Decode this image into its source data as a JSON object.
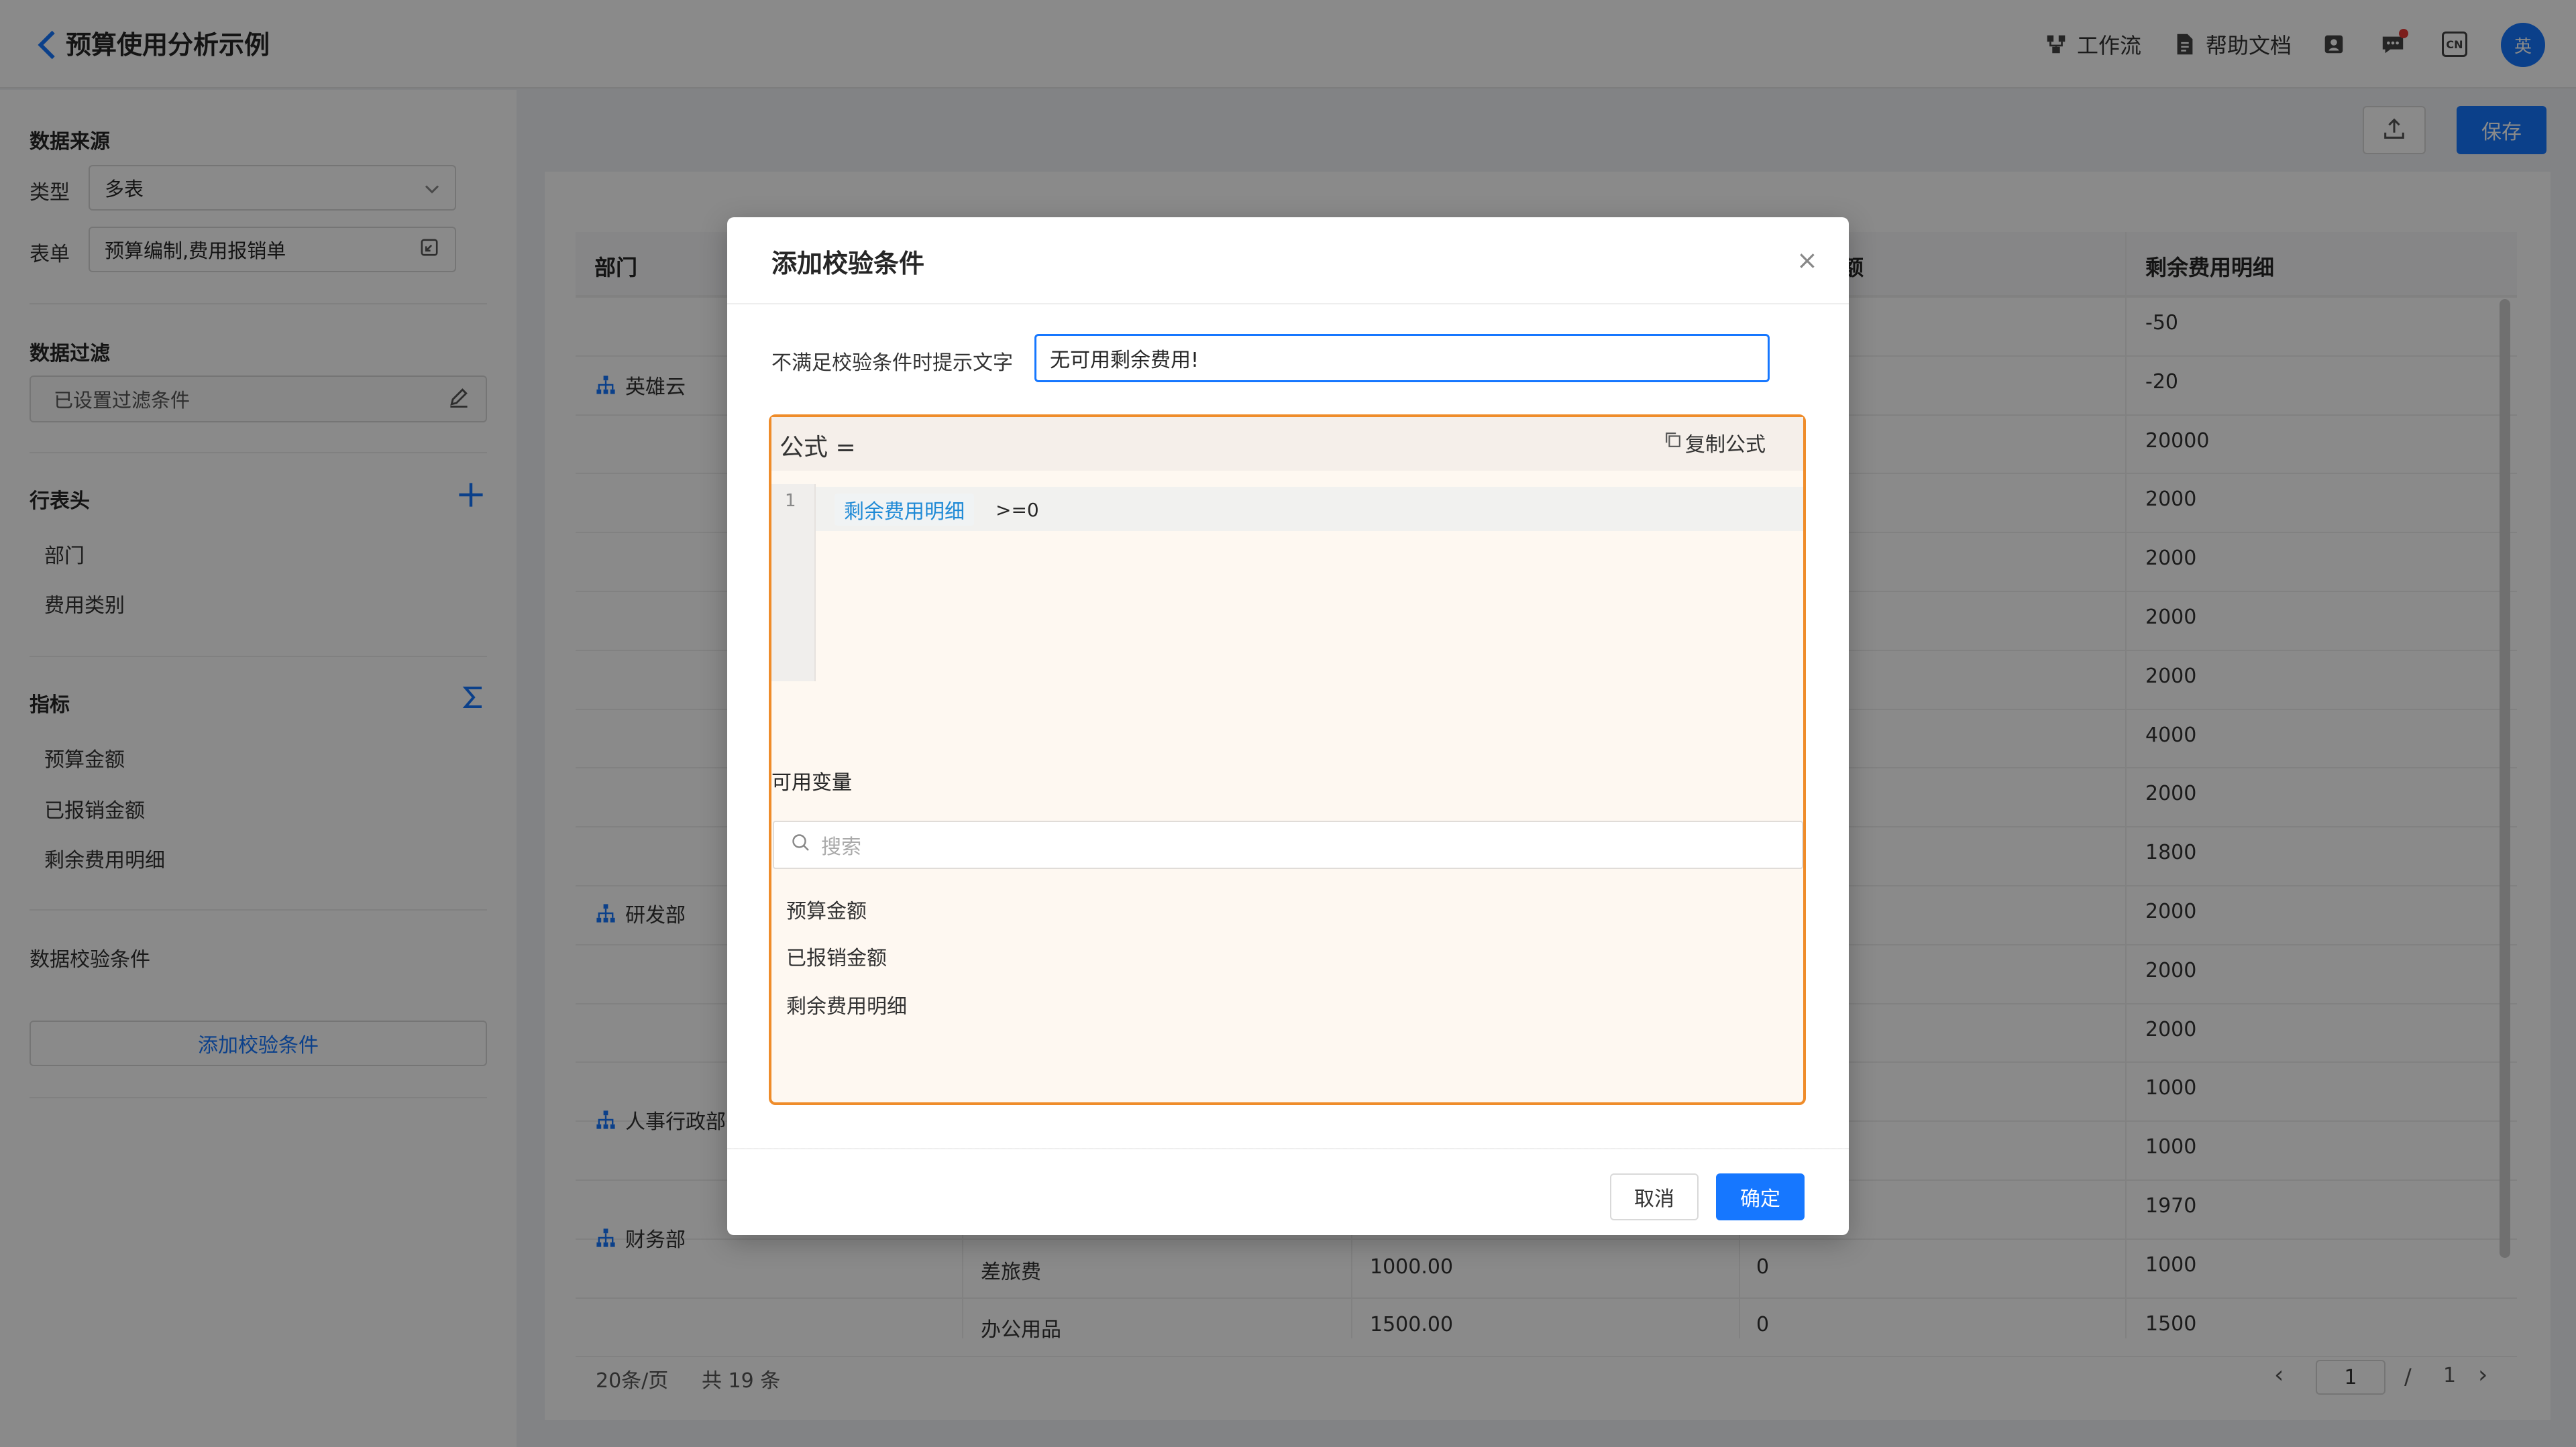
{
  "header": {
    "title": "预算使用分析示例",
    "workflow_label": "工作流",
    "help_label": "帮助文档",
    "lang_label": "CN",
    "avatar_text": "英"
  },
  "left_panel": {
    "data_source_title": "数据来源",
    "type_label": "类型",
    "type_value": "多表",
    "form_label": "表单",
    "form_value": "预算编制,费用报销单",
    "filter_title": "数据过滤",
    "filter_value": "已设置过滤条件",
    "row_header_title": "行表头",
    "row_headers": [
      "部门",
      "费用类别"
    ],
    "metrics_title": "指标",
    "metrics": [
      "预算金额",
      "已报销金额",
      "剩余费用明细"
    ],
    "validation_title": "数据校验条件",
    "add_validation_label": "添加校验条件"
  },
  "toolbar": {
    "save_label": "保存"
  },
  "table": {
    "columns": {
      "dept": "部门",
      "reimbursed_partial": "额",
      "remaining": "剩余费用明细"
    },
    "departments": [
      "英雄云",
      "研发部",
      "人事行政部",
      "财务部"
    ],
    "remaining_values": [
      "-50",
      "-20",
      "20000",
      "2000",
      "2000",
      "2000",
      "2000",
      "4000",
      "2000",
      "1800",
      "2000",
      "2000",
      "2000",
      "1000",
      "1000",
      "1970",
      "1000",
      "1500"
    ],
    "bottom_rows": [
      {
        "category": "差旅费",
        "budget": "1000.00",
        "reimbursed": "0"
      },
      {
        "category": "办公用品",
        "budget": "1500.00",
        "reimbursed": "0"
      }
    ],
    "pager": {
      "page_size": "20条/页",
      "total": "共 19 条",
      "current": "1",
      "slash": "/",
      "pages": "1",
      "prev": "‹",
      "next": "›"
    }
  },
  "modal": {
    "title": "添加校验条件",
    "close": "×",
    "prompt_label": "不满足校验条件时提示文字",
    "prompt_value": "无可用剩余费用!",
    "formula_label": "公式 =",
    "copy_formula": "复制公式",
    "line_number": "1",
    "token": "剩余费用明细",
    "operator": ">=0",
    "vars_title": "可用变量",
    "search_placeholder": "搜索",
    "variables": [
      "预算金额",
      "已报销金额",
      "剩余费用明细"
    ],
    "cancel_label": "取消",
    "ok_label": "确定"
  },
  "colors": {
    "accent": "#1677ff",
    "formula_border": "#ef8c2a",
    "token_text": "#1f8ad6"
  }
}
